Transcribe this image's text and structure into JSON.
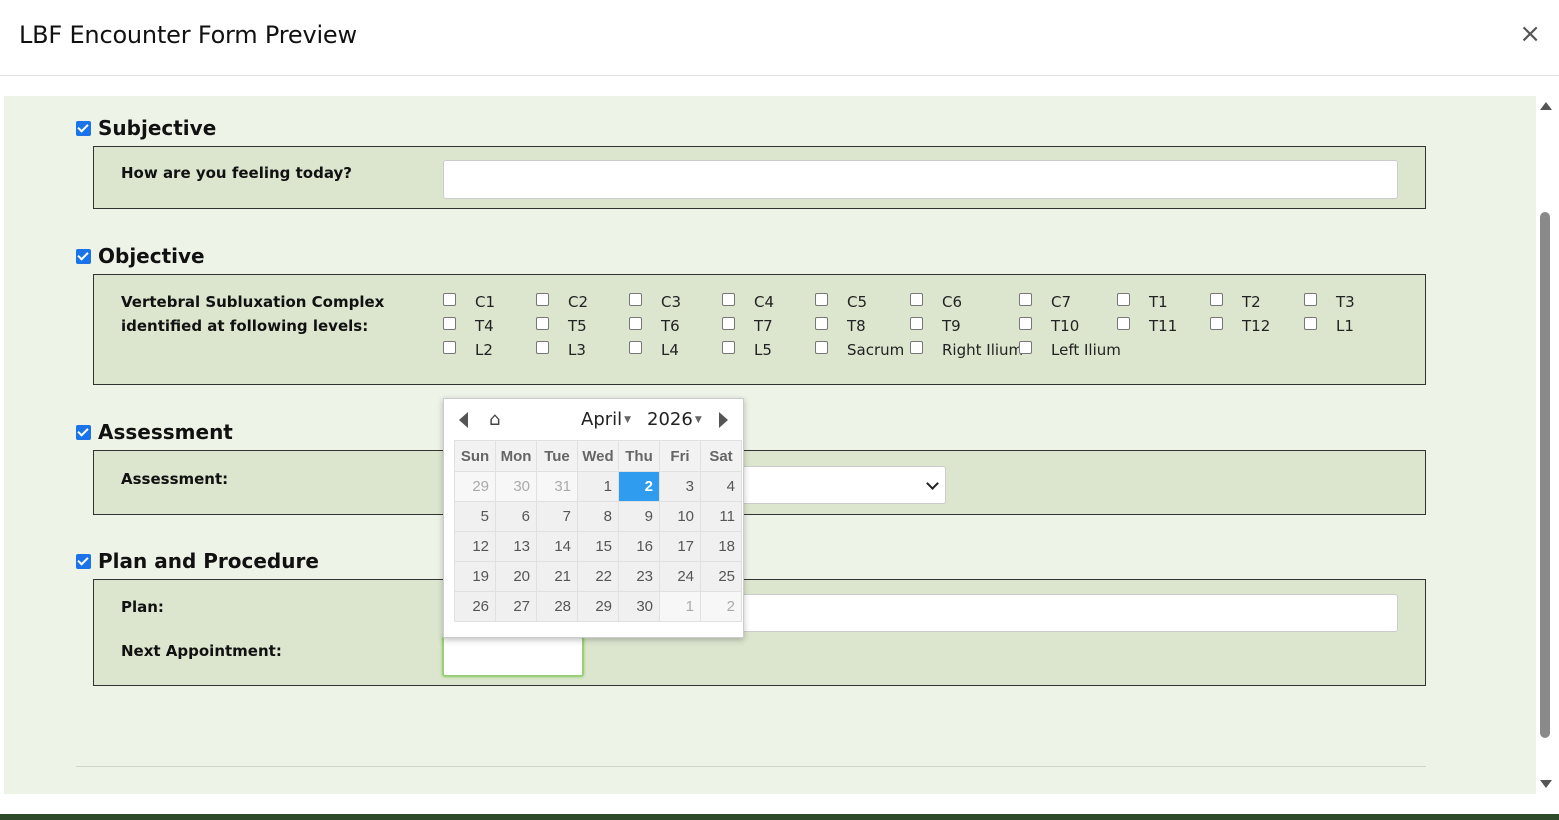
{
  "header": {
    "title": "LBF Encounter Form Preview",
    "close_glyph": "×"
  },
  "sections": {
    "subjective": {
      "title": "Subjective",
      "checked": true,
      "field_label": "How are you feeling today?",
      "field_value": ""
    },
    "objective": {
      "title": "Objective",
      "checked": true,
      "field_label_line1": "Vertebral Subluxation Complex",
      "field_label_line2": "identified at following levels:",
      "levels": [
        "C1",
        "C2",
        "C3",
        "C4",
        "C5",
        "C6",
        "C7",
        "T1",
        "T2",
        "T3",
        "T4",
        "T5",
        "T6",
        "T7",
        "T8",
        "T9",
        "T10",
        "T11",
        "T12",
        "L1",
        "L2",
        "L3",
        "L4",
        "L5",
        "Sacrum",
        "Right Ilium",
        "Left Ilium"
      ]
    },
    "assessment": {
      "title": "Assessment",
      "checked": true,
      "field_label": "Assessment:",
      "selected_value": ""
    },
    "plan": {
      "title": "Plan and Procedure",
      "checked": true,
      "plan_label": "Plan:",
      "plan_value": "",
      "next_appointment_label": "Next Appointment:",
      "next_appointment_value": ""
    }
  },
  "calendar": {
    "home_glyph": "⌂",
    "month": "April",
    "year": "2026",
    "weekdays": [
      "Sun",
      "Mon",
      "Tue",
      "Wed",
      "Thu",
      "Fri",
      "Sat"
    ],
    "weeks": [
      [
        "29",
        "30",
        "31",
        "1",
        "2",
        "3",
        "4"
      ],
      [
        "5",
        "6",
        "7",
        "8",
        "9",
        "10",
        "11"
      ],
      [
        "12",
        "13",
        "14",
        "15",
        "16",
        "17",
        "18"
      ],
      [
        "19",
        "20",
        "21",
        "22",
        "23",
        "24",
        "25"
      ],
      [
        "26",
        "27",
        "28",
        "29",
        "30",
        "1",
        "2"
      ]
    ],
    "today": "2",
    "colors": {
      "today_bg": "#2f9cf0",
      "accent": "#1a73e8"
    }
  }
}
